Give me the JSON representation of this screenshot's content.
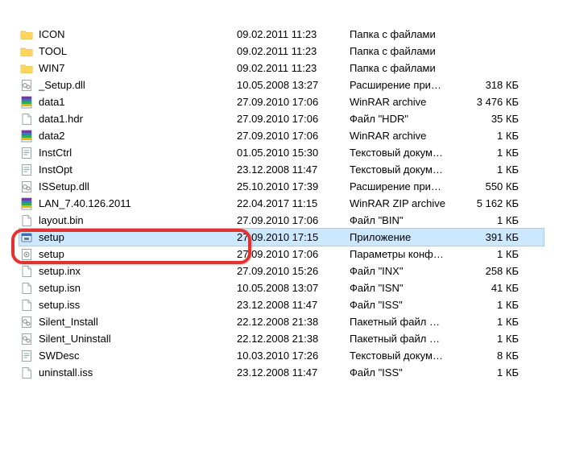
{
  "files": [
    {
      "icon": "folder",
      "name": "ICON",
      "date": "09.02.2011 11:23",
      "type": "Папка с файлами",
      "size": ""
    },
    {
      "icon": "folder",
      "name": "TOOL",
      "date": "09.02.2011 11:23",
      "type": "Папка с файлами",
      "size": ""
    },
    {
      "icon": "folder",
      "name": "WIN7",
      "date": "09.02.2011 11:23",
      "type": "Папка с файлами",
      "size": ""
    },
    {
      "icon": "dll",
      "name": "_Setup.dll",
      "date": "10.05.2008 13:27",
      "type": "Расширение при…",
      "size": "318 КБ"
    },
    {
      "icon": "rar",
      "name": "data1",
      "date": "27.09.2010 17:06",
      "type": "WinRAR archive",
      "size": "3 476 КБ"
    },
    {
      "icon": "file",
      "name": "data1.hdr",
      "date": "27.09.2010 17:06",
      "type": "Файл \"HDR\"",
      "size": "35 КБ"
    },
    {
      "icon": "rar",
      "name": "data2",
      "date": "27.09.2010 17:06",
      "type": "WinRAR archive",
      "size": "1 КБ"
    },
    {
      "icon": "txt",
      "name": "InstCtrl",
      "date": "01.05.2010 15:30",
      "type": "Текстовый докум…",
      "size": "1 КБ"
    },
    {
      "icon": "txt",
      "name": "InstOpt",
      "date": "23.12.2008 11:47",
      "type": "Текстовый докум…",
      "size": "1 КБ"
    },
    {
      "icon": "dll",
      "name": "ISSetup.dll",
      "date": "25.10.2010 17:39",
      "type": "Расширение при…",
      "size": "550 КБ"
    },
    {
      "icon": "rar",
      "name": "LAN_7.40.126.2011",
      "date": "22.04.2017 11:15",
      "type": "WinRAR ZIP archive",
      "size": "5 162 КБ"
    },
    {
      "icon": "file",
      "name": "layout.bin",
      "date": "27.09.2010 17:06",
      "type": "Файл \"BIN\"",
      "size": "1 КБ"
    },
    {
      "icon": "exe",
      "name": "setup",
      "date": "27.09.2010 17:15",
      "type": "Приложение",
      "size": "391 КБ",
      "selected": true
    },
    {
      "icon": "cfg",
      "name": "setup",
      "date": "27.09.2010 17:06",
      "type": "Параметры конф…",
      "size": "1 КБ"
    },
    {
      "icon": "file",
      "name": "setup.inx",
      "date": "27.09.2010 15:26",
      "type": "Файл \"INX\"",
      "size": "258 КБ"
    },
    {
      "icon": "file",
      "name": "setup.isn",
      "date": "10.05.2008 13:07",
      "type": "Файл \"ISN\"",
      "size": "41 КБ"
    },
    {
      "icon": "file",
      "name": "setup.iss",
      "date": "23.12.2008 11:47",
      "type": "Файл \"ISS\"",
      "size": "1 КБ"
    },
    {
      "icon": "bat",
      "name": "Silent_Install",
      "date": "22.12.2008 21:38",
      "type": "Пакетный файл …",
      "size": "1 КБ"
    },
    {
      "icon": "bat",
      "name": "Silent_Uninstall",
      "date": "22.12.2008 21:38",
      "type": "Пакетный файл …",
      "size": "1 КБ"
    },
    {
      "icon": "txt",
      "name": "SWDesc",
      "date": "10.03.2010 17:26",
      "type": "Текстовый докум…",
      "size": "8 КБ"
    },
    {
      "icon": "file",
      "name": "uninstall.iss",
      "date": "23.12.2008 11:47",
      "type": "Файл \"ISS\"",
      "size": "1 КБ"
    }
  ]
}
